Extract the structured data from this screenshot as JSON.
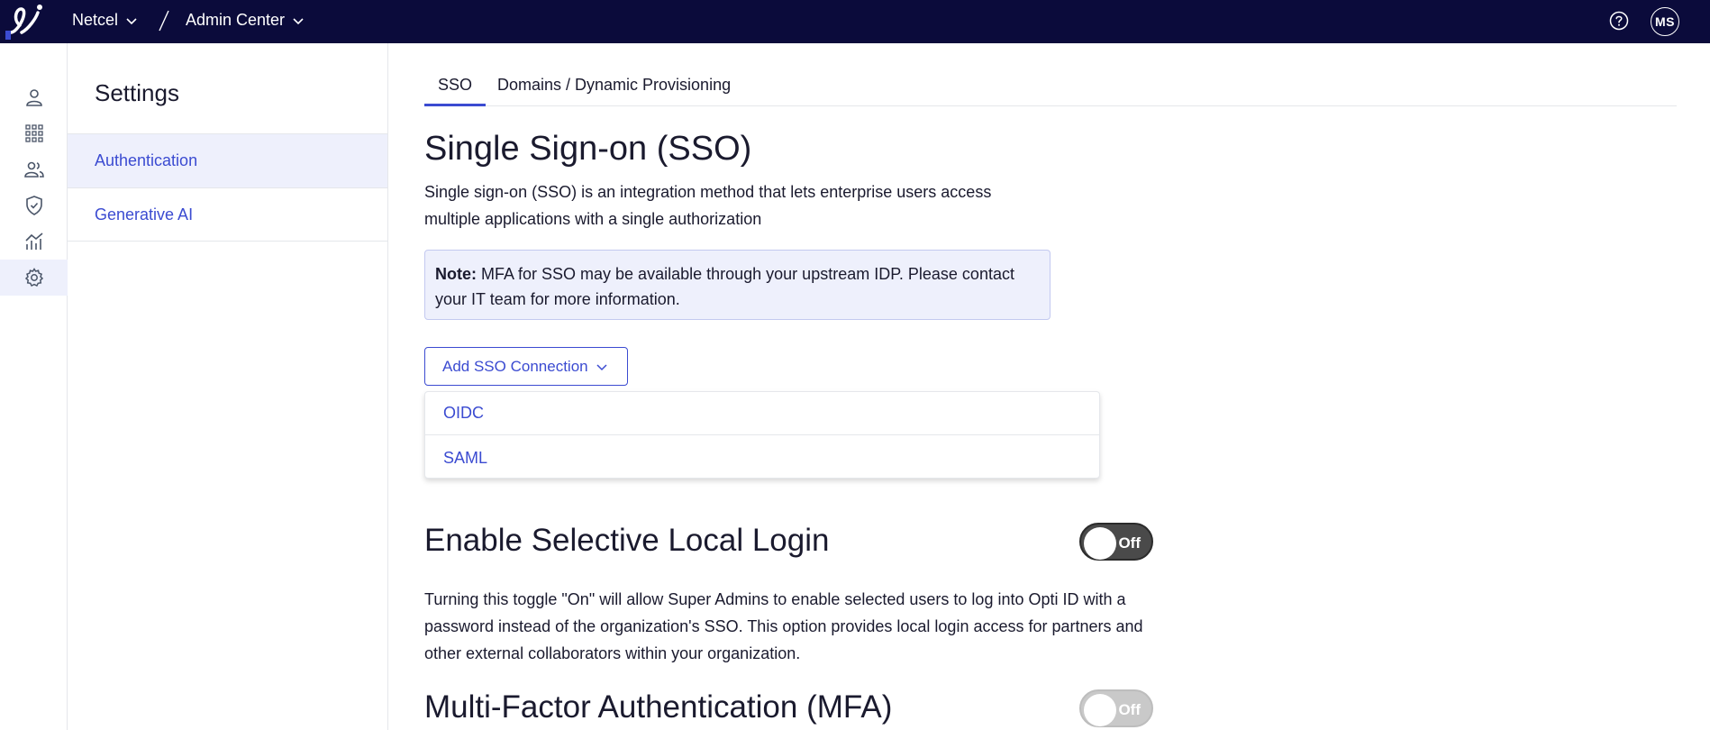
{
  "topbar": {
    "org": "Netcel",
    "app": "Admin Center",
    "avatar_initials": "MS",
    "bg_color": "#0b0b3b"
  },
  "rail": {
    "icons": [
      "user-icon",
      "apps-grid-icon",
      "users-icon",
      "shield-icon",
      "analytics-icon",
      "settings-gear-icon"
    ],
    "active": "settings-gear-icon"
  },
  "settings": {
    "title": "Settings",
    "items": [
      {
        "label": "Authentication",
        "active": true
      },
      {
        "label": "Generative AI",
        "active": false
      }
    ]
  },
  "tabs": [
    {
      "label": "SSO",
      "active": true
    },
    {
      "label": "Domains / Dynamic Provisioning",
      "active": false
    }
  ],
  "sso": {
    "title": "Single Sign-on (SSO)",
    "description": "Single sign-on (SSO) is an integration method that lets enterprise users access multiple applications with a single authorization",
    "note_label": "Note:",
    "note_text": " MFA for SSO may be available through your upstream IDP. Please contact your IT team for more information.",
    "add_button": "Add SSO Connection",
    "dropdown_options": [
      "OIDC",
      "SAML"
    ]
  },
  "selective_login": {
    "title": "Enable Selective Local Login",
    "toggle_label": "Off",
    "description": "Turning this toggle \"On\" will allow Super Admins to enable selected users to log into Opti ID with a password instead of the organization's SSO. This option provides local login access for partners and other external collaborators within your organization."
  },
  "mfa": {
    "title": "Multi-Factor Authentication (MFA)",
    "toggle_label": "Off"
  },
  "colors": {
    "accent": "#3b4bd1",
    "note_bg": "#eef0fc"
  }
}
